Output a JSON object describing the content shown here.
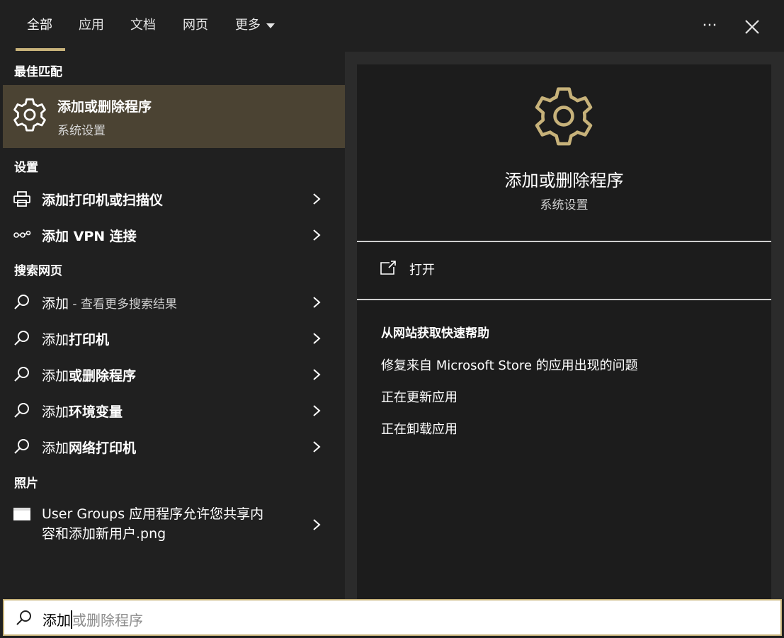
{
  "tabs": {
    "all": "全部",
    "apps": "应用",
    "docs": "文档",
    "web": "网页",
    "more": "更多"
  },
  "toolbar": {
    "options": "···",
    "close": "✕"
  },
  "sections": {
    "best_match": "最佳匹配",
    "settings": "设置",
    "web_search": "搜索网页",
    "photos": "照片"
  },
  "best_match": {
    "title": "添加或删除程序",
    "subtitle": "系统设置",
    "icon": "gear-icon"
  },
  "settings_items": [
    {
      "prefix": "添加",
      "rest": "打印机或扫描仪",
      "icon": "printer-icon"
    },
    {
      "prefix": "添加",
      "rest": " VPN 连接",
      "icon": "vpn-icon"
    }
  ],
  "web_items": [
    {
      "prefix": "添加",
      "rest": " - 查看更多搜索结果",
      "icon": "search-icon"
    },
    {
      "prefix": "添加",
      "rest": "打印机",
      "icon": "search-icon"
    },
    {
      "prefix": "添加",
      "rest": "或删除程序",
      "icon": "search-icon"
    },
    {
      "prefix": "添加",
      "rest": "环境变量",
      "icon": "search-icon"
    },
    {
      "prefix": "添加",
      "rest": "网络打印机",
      "icon": "search-icon"
    }
  ],
  "photo_item": {
    "line1": "User Groups 应用程序允许您共享内",
    "line2": "容和添加新用户.png",
    "icon": "image-icon"
  },
  "detail": {
    "title": "添加或删除程序",
    "subtitle": "系统设置",
    "open_label": "打开",
    "help_title": "从网站获取快速帮助",
    "help_links": [
      "修复来自 Microsoft Store 的应用出现的问题",
      "正在更新应用",
      "正在卸载应用"
    ]
  },
  "search": {
    "typed": "添加",
    "suggestion": "或删除程序"
  },
  "colors": {
    "accent": "#c7b27a",
    "selected_bg": "#4b4333",
    "panel_bg": "#202020",
    "detail_bg": "#1c1c1c"
  }
}
